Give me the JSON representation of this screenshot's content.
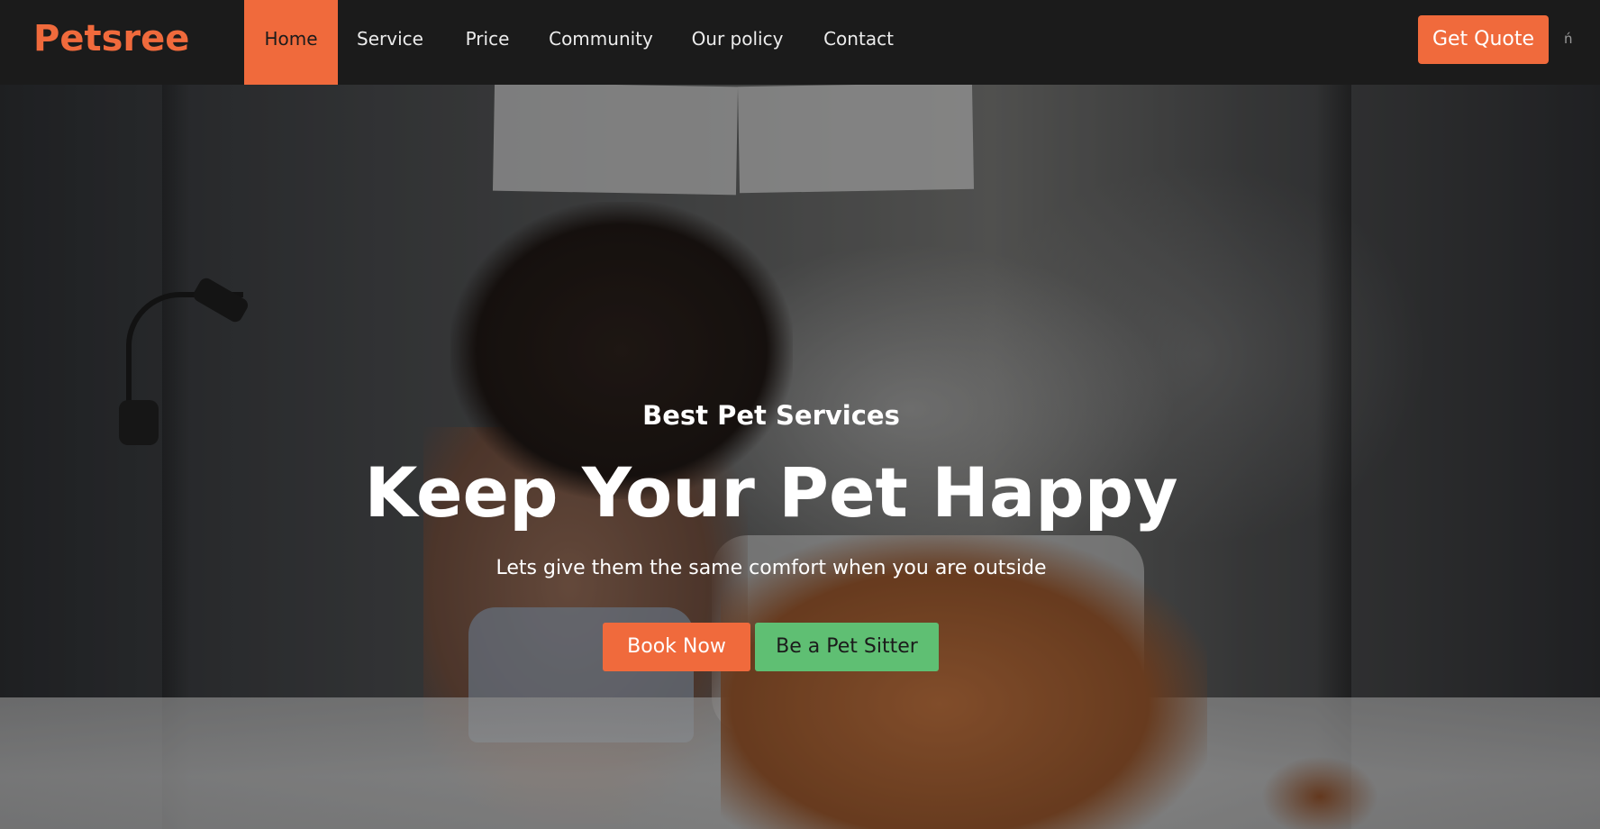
{
  "brand": {
    "logo": "Petsree",
    "accent_color": "#f06a3c",
    "secondary_color": "#5fbf73"
  },
  "nav": {
    "items": [
      {
        "label": "Home",
        "active": true
      },
      {
        "label": "Service",
        "active": false
      },
      {
        "label": "Price",
        "active": false
      },
      {
        "label": "Community",
        "active": false
      },
      {
        "label": "Our policy",
        "active": false
      },
      {
        "label": "Contact",
        "active": false
      }
    ],
    "cta_label": "Get Quote",
    "trailing_glyph": "ń"
  },
  "hero": {
    "subtitle": "Best Pet Services",
    "headline": "Keep Your Pet Happy",
    "tagline": "Lets give them the same comfort when you are outside",
    "primary_button": "Book Now",
    "secondary_button": "Be a Pet Sitter",
    "background_image": "woman-with-dog-on-bed-photo"
  }
}
